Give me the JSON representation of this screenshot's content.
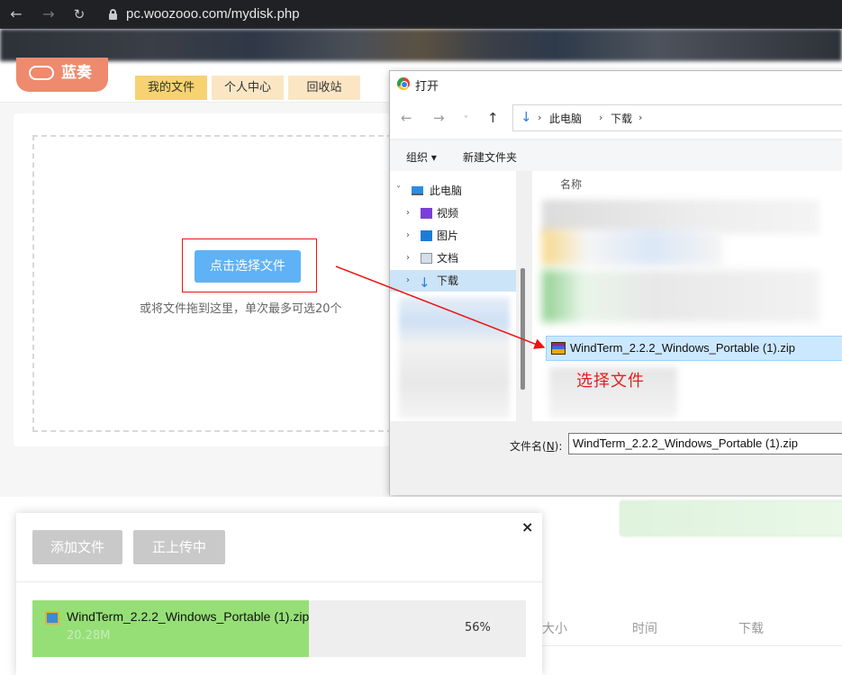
{
  "browser": {
    "url": "pc.woozooo.com/mydisk.php",
    "icons": {
      "back": "arrow-left",
      "forward": "arrow-right",
      "reload": "reload",
      "lock": "lock"
    }
  },
  "site": {
    "logo_text": "蓝奏",
    "nav_tabs": [
      "我的文件",
      "个人中心",
      "回收站"
    ],
    "select_file_button": "点击选择文件",
    "drop_hint": "或将文件拖到这里，单次最多可选20个"
  },
  "dialog": {
    "title": "打开",
    "breadcrumbs": [
      "此电脑",
      "下载"
    ],
    "toolbar": {
      "organize": "组织 ▾",
      "new_folder": "新建文件夹"
    },
    "tree": [
      {
        "label": "此电脑",
        "expanded": true
      },
      {
        "label": "视频"
      },
      {
        "label": "图片"
      },
      {
        "label": "文档"
      },
      {
        "label": "下载",
        "selected": true
      }
    ],
    "column_name": "名称",
    "selected_file": "WindTerm_2.2.2_Windows_Portable (1).zip",
    "filename_label_prefix": "文件名(",
    "filename_label_key": "N",
    "filename_label_suffix": "):",
    "filename_value": "WindTerm_2.2.2_Windows_Portable (1).zip"
  },
  "annotation": {
    "text": "选择文件",
    "color": "#e02020"
  },
  "upload_modal": {
    "close": "×",
    "add_file_button": "添加文件",
    "uploading_button": "正上传中",
    "item": {
      "name": "WindTerm_2.2.2_Windows_Portable (1).zip",
      "size": "20.28M",
      "progress_percent": 56,
      "progress_text": "56%"
    }
  },
  "file_table_headers": [
    "大小",
    "时间",
    "下载"
  ],
  "colors": {
    "brand": "#ee8a6e",
    "select_button": "#5fb2f6",
    "progress": "#96df77",
    "active_tab": "#f6d271"
  }
}
